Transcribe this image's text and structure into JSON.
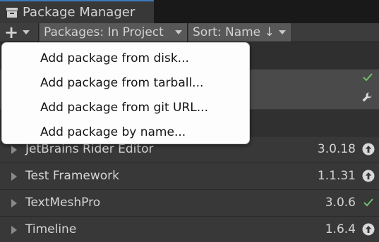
{
  "window": {
    "title": "Package Manager"
  },
  "toolbar": {
    "add_button_icon": "plus-icon",
    "filter_label": "Packages: In Project",
    "sort_label": "Sort: Name ↓"
  },
  "add_menu": {
    "items": [
      {
        "label": "Add package from disk..."
      },
      {
        "label": "Add package from tarball..."
      },
      {
        "label": "Add package from git URL..."
      },
      {
        "label": "Add package by name..."
      }
    ]
  },
  "selected_row": {
    "status_icons": [
      "check-icon",
      "wrench-icon"
    ]
  },
  "packages": [
    {
      "name": "JetBrains Rider Editor",
      "version": "3.0.18",
      "status_icon": "update-available-icon"
    },
    {
      "name": "Test Framework",
      "version": "1.1.31",
      "status_icon": "update-available-icon"
    },
    {
      "name": "TextMeshPro",
      "version": "3.0.6",
      "status_icon": "check-icon"
    },
    {
      "name": "Timeline",
      "version": "1.6.4",
      "status_icon": "update-available-icon"
    }
  ],
  "colors": {
    "check": "#6fc06f",
    "update_icon_fill": "#d8d8d8",
    "menu_bg": "#fdfdfd",
    "window_bg": "#383838",
    "selected_row_bg": "#4a4a4a"
  }
}
